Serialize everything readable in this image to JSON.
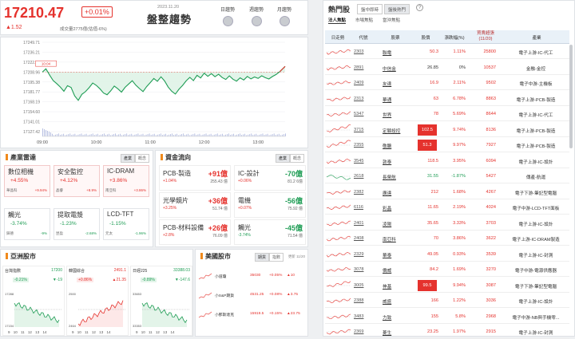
{
  "quote": {
    "value": "17210.47",
    "pct": "+0.01%",
    "change": "▲1.52",
    "volume": "成交量2775億(估值-6%)",
    "date": "2023.11.20",
    "title": "盤整趨勢",
    "trend_buttons": [
      "日趨勢",
      "週趨勢",
      "月趨勢"
    ]
  },
  "chart_data": {
    "type": "line",
    "title": "",
    "y_ticks": [
      "17249.71",
      "17236.21",
      "17222.54",
      "17208.96",
      "17195.38",
      "17181.77",
      "17168.19",
      "17154.60",
      "17141.01",
      "17127.42"
    ],
    "x_ticks": [
      "09:00",
      "10:00",
      "11:00",
      "12:00",
      "13:00"
    ],
    "ylim": [
      17127.42,
      17249.71
    ],
    "x": [
      0,
      4,
      8,
      12,
      16,
      20,
      24,
      28,
      32,
      36,
      40,
      44,
      48,
      52,
      56,
      60,
      64,
      68,
      72,
      76,
      80,
      84,
      88,
      92,
      96,
      100,
      104,
      108,
      112,
      116,
      120,
      124,
      128,
      132,
      136,
      140,
      144,
      148,
      152,
      156,
      160,
      164,
      168,
      172,
      176,
      180,
      184,
      188,
      192,
      196,
      200,
      204,
      208,
      212,
      216,
      220,
      224,
      228,
      232,
      236,
      240,
      244,
      248,
      252,
      256,
      260,
      264,
      270
    ],
    "values": [
      17208.9,
      17213.5,
      17205.1,
      17197.4,
      17193.2,
      17188.5,
      17182.7,
      17190.2,
      17187.9,
      17176.3,
      17170.2,
      17178.4,
      17182.1,
      17187.5,
      17193.9,
      17190.7,
      17186.1,
      17180.3,
      17177.9,
      17183.2,
      17189.8,
      17186.0,
      17181.5,
      17188.0,
      17192.6,
      17197.1,
      17191.0,
      17186.4,
      17182.2,
      17189.0,
      17194.5,
      17200.1,
      17196.3,
      17202.4,
      17196.8,
      17188.3,
      17182.6,
      17178.9,
      17185.4,
      17190.6,
      17196.9,
      17201.7,
      17197.2,
      17204.5,
      17200.9,
      17207.3,
      17203.1,
      17206.8,
      17202.5,
      17205.9,
      17201.4,
      17198.8,
      17203.7,
      17199.2,
      17196.5,
      17201.0,
      17198.1,
      17203.0,
      17199.6,
      17202.2,
      17200.3,
      17203.8,
      17201.2,
      17199.5,
      17202.9,
      17205.6,
      17209.4,
      17216.7
    ],
    "reference": 17208.96,
    "annotation": "10:04"
  },
  "sectors": {
    "title": "產業雷達",
    "tabs": [
      "產業",
      "概念"
    ],
    "cards": [
      {
        "name": "數位相機",
        "pct": "+4.55%",
        "sub1": "華晶科",
        "sub2": "+9.94%",
        "dir": "up"
      },
      {
        "name": "安全監控",
        "pct": "+4.12%",
        "sub1": "晶睿",
        "sub2": "+8.9%",
        "dir": "up"
      },
      {
        "name": "IC-DRAM",
        "pct": "+3.86%",
        "sub1": "南亞科",
        "sub2": "+3.86%",
        "dir": "up"
      },
      {
        "name": "觸光",
        "pct": "-3.74%",
        "sub1": "錸德",
        "sub2": "-9%",
        "dir": "down"
      },
      {
        "name": "提取電漿",
        "pct": "-1.23%",
        "sub1": "昆盈",
        "sub2": "-2.68%",
        "dir": "down"
      },
      {
        "name": "LCD-TFT",
        "pct": "-1.15%",
        "sub1": "元太",
        "sub2": "-1.96%",
        "dir": "down"
      }
    ]
  },
  "flow": {
    "title": "資金流向",
    "tabs": [
      "產業",
      "概念"
    ],
    "cards": [
      {
        "name": "PCB-製造",
        "amt": "+91億",
        "pct": "+1.04%",
        "vol": "255.43 億",
        "dir": "up"
      },
      {
        "name": "IC-設計",
        "amt": "-70億",
        "pct": "+0.06%",
        "vol": "81.2 6億",
        "dir": "down"
      },
      {
        "name": "光學鏡片",
        "amt": "+36億",
        "pct": "+3.25%",
        "vol": "51.74 億",
        "dir": "up"
      },
      {
        "name": "電機",
        "amt": "-56億",
        "pct": "+0.07%",
        "vol": "75.92 億",
        "dir": "down"
      },
      {
        "name": "PCB-材料設備",
        "amt": "+26億",
        "pct": "+2.8%",
        "vol": "76.09 億",
        "dir": "up"
      },
      {
        "name": "觸光",
        "amt": "-45億",
        "pct": "-3.74%",
        "vol": "71.54 億",
        "dir": "down"
      }
    ]
  },
  "asia": {
    "title": "亞洲股市",
    "markets": [
      {
        "name": "台灣指數",
        "value": "17200",
        "pct": "-0.21%",
        "chg": "▼-19",
        "lo": "17154",
        "hi": "17288",
        "dir": "down"
      },
      {
        "name": "韓國綜合",
        "value": "2491.1",
        "pct": "+0.86%",
        "chg": "▲21.35",
        "lo": "2464",
        "hi": "2500",
        "dir": "up"
      },
      {
        "name": "日經225",
        "value": "33388.03",
        "pct": "-0.89%",
        "chg": "▼-147.6",
        "lo": "33353",
        "hi": "33653",
        "dir": "down"
      }
    ],
    "x_ticks": "9 10 11 12 13 14"
  },
  "us": {
    "title": "美國股市",
    "tabs": [
      "期貨",
      "指數"
    ],
    "update": "更新 11/20",
    "rows": [
      {
        "name": "小道瓊",
        "value": "35030",
        "pct": "+0.05%",
        "chg": "▲10"
      },
      {
        "name": "小S&P期貨",
        "value": "4531.25",
        "pct": "+0.08%",
        "chg": "▲3.75"
      },
      {
        "name": "小那斯達克",
        "value": "15919.5",
        "pct": "+0.15%",
        "chg": "▲23.75"
      }
    ]
  },
  "hot": {
    "title": "熱門股",
    "tabs": [
      "盤中即時",
      "盤後熱門"
    ],
    "subtabs": [
      "法人焦點",
      "市場焦點",
      "當沖焦點"
    ],
    "headers": [
      "日走勢",
      "代號",
      "股票",
      "股價",
      "漲跌幅(%)",
      "買賣超張\n(11/20)",
      "產業"
    ],
    "rows": [
      {
        "code": "2303",
        "name": "聯電",
        "price": "50.3",
        "pct": "1.11%",
        "vol": "25800",
        "ind": "電子上游-IC-代工",
        "lim": false
      },
      {
        "code": "2891",
        "name": "中信金",
        "price": "26.85",
        "pct": "0%",
        "vol": "10537",
        "ind": "金融-金控",
        "lim": false
      },
      {
        "code": "2409",
        "name": "友達",
        "price": "16.9",
        "pct": "2.11%",
        "vol": "9502",
        "ind": "電子中游-主機板",
        "lim": false
      },
      {
        "code": "2313",
        "name": "華通",
        "price": "63",
        "pct": "6.78%",
        "vol": "8863",
        "ind": "電子上游-PCB-製造",
        "lim": false
      },
      {
        "code": "5347",
        "name": "世界",
        "price": "78",
        "pct": "5.69%",
        "vol": "8644",
        "ind": "電子上游-IC-代工",
        "lim": false
      },
      {
        "code": "3715",
        "name": "定穎投控",
        "price": "102.5",
        "pct": "9.74%",
        "vol": "8136",
        "ind": "電子上游-PCB-製造",
        "lim": true
      },
      {
        "code": "2355",
        "name": "敬鵬",
        "price": "51.3",
        "pct": "9.97%",
        "vol": "7927",
        "ind": "電子上游-PCB-製造",
        "lim": true
      },
      {
        "code": "3545",
        "name": "敦泰",
        "price": "118.5",
        "pct": "3.95%",
        "vol": "6094",
        "ind": "電子上游-IC-設計",
        "lim": false
      },
      {
        "code": "2618",
        "name": "長榮航",
        "price": "31.55",
        "pct": "-1.87%",
        "vol": "5427",
        "ind": "傳產-航運",
        "lim": false
      },
      {
        "code": "2382",
        "name": "廣達",
        "price": "212",
        "pct": "1.68%",
        "vol": "4267",
        "ind": "電子下游-筆記型電腦",
        "lim": false
      },
      {
        "code": "6116",
        "name": "彩晶",
        "price": "11.65",
        "pct": "2.19%",
        "vol": "4024",
        "ind": "電子中游-LCD-TFT面板",
        "lim": false
      },
      {
        "code": "2401",
        "name": "凌陽",
        "price": "35.65",
        "pct": "3.33%",
        "vol": "3703",
        "ind": "電子上游-IC-設計",
        "lim": false
      },
      {
        "code": "2408",
        "name": "南亞科",
        "price": "70",
        "pct": "3.86%",
        "vol": "3622",
        "ind": "電子上游-IC-DRAM製造",
        "lim": false
      },
      {
        "code": "2329",
        "name": "華泰",
        "price": "49.05",
        "pct": "0.93%",
        "vol": "3539",
        "ind": "電子上游-IC-封測",
        "lim": false
      },
      {
        "code": "3078",
        "name": "僑威",
        "price": "84.2",
        "pct": "1.69%",
        "vol": "3270",
        "ind": "電子中游-電源供應器",
        "lim": false
      },
      {
        "code": "3005",
        "name": "神基",
        "price": "99.5",
        "pct": "9.94%",
        "vol": "3087",
        "ind": "電子下游-筆記型電腦",
        "lim": true
      },
      {
        "code": "2388",
        "name": "威盛",
        "price": "166",
        "pct": "1.22%",
        "vol": "3036",
        "ind": "電子上游-IC-設計",
        "lim": false
      },
      {
        "code": "3483",
        "name": "力致",
        "price": "155",
        "pct": "5.8%",
        "vol": "2968",
        "ind": "電子中游-NB與手機零...",
        "lim": false
      },
      {
        "code": "2369",
        "name": "菱生",
        "price": "23.25",
        "pct": "1.97%",
        "vol": "2915",
        "ind": "電子上游-IC-封測",
        "lim": false
      }
    ]
  }
}
